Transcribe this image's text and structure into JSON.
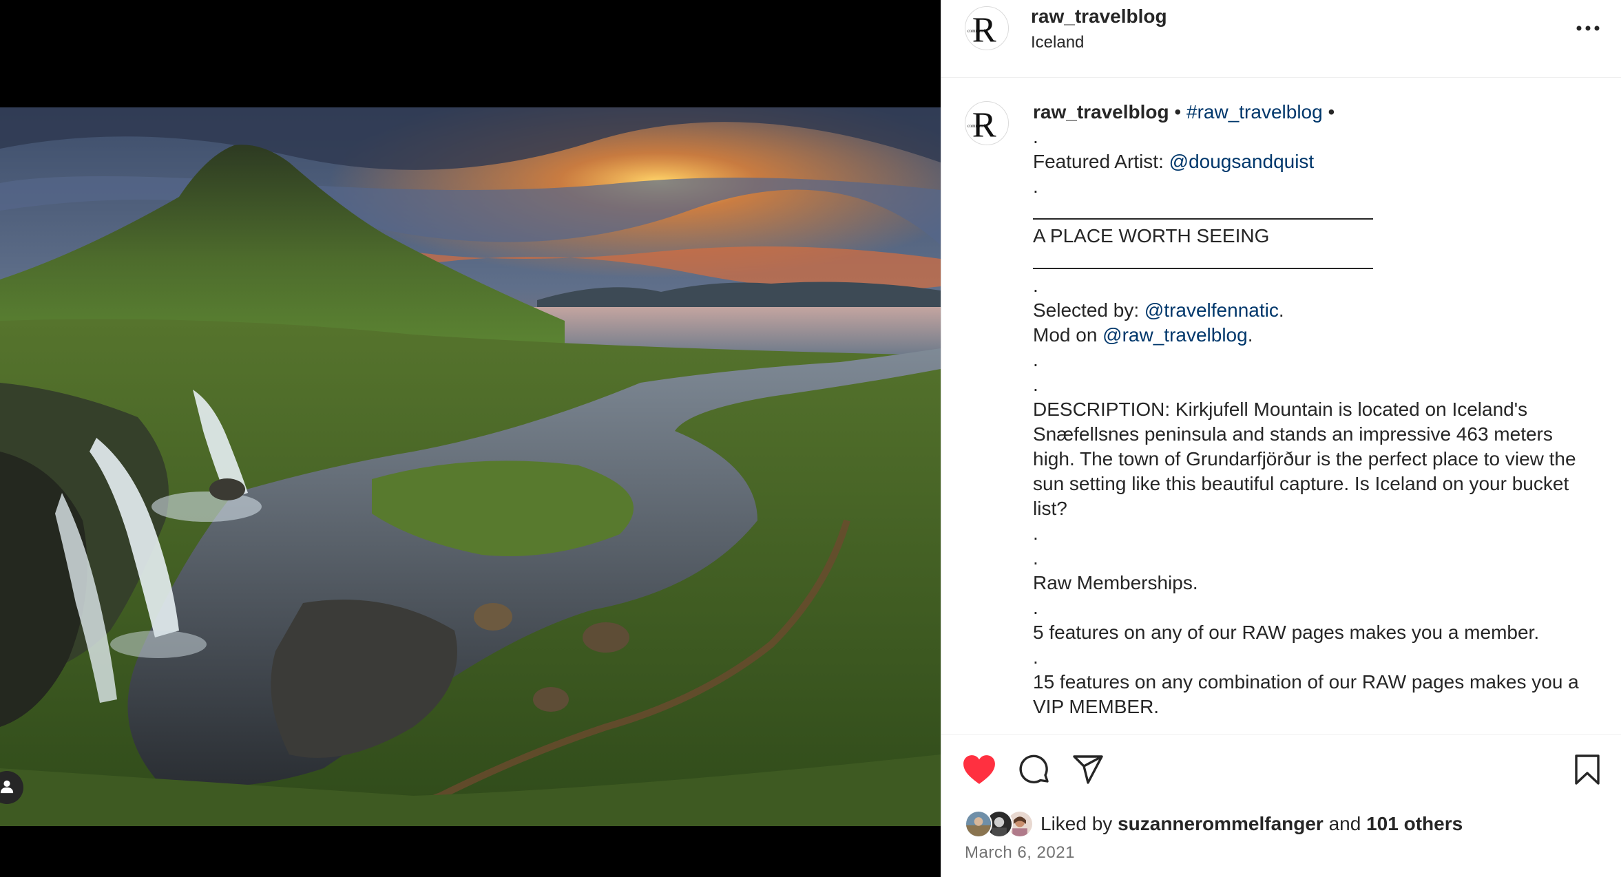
{
  "header": {
    "username": "raw_travelblog",
    "location": "Iceland"
  },
  "caption": {
    "username": "raw_travelblog",
    "sep1": " • ",
    "hashtag": "#raw_travelblog",
    "sep2": " •",
    "dot": ".",
    "featured_prefix": "Featured Artist: ",
    "featured_handle": "@dougsandquist",
    "heading": "A PLACE WORTH SEEING",
    "selected_prefix": "Selected by: ",
    "selected_handle": "@travelfennatic",
    "period": ".",
    "mod_prefix": "Mod on ",
    "mod_handle": "@raw_travelblog",
    "description": "DESCRIPTION: Kirkjufell Mountain is located on Iceland's Snæfellsnes peninsula and stands an impressive 463 meters high. The town of Grundarfjörður is the perfect place to view the sun setting like this beautiful capture. Is Iceland on your bucket list?",
    "memberships": "Raw Memberships.",
    "member_rule": "5 features on any of our RAW pages makes you a member.",
    "vip_rule": "15 features on any combination of our RAW pages makes you a VIP MEMBER."
  },
  "likes": {
    "prefix": "Liked by ",
    "user": "suzannerommelfanger",
    "middle": " and ",
    "others": "101 others"
  },
  "date": "March 6, 2021",
  "icons": {
    "more": "more-horizontal-icon",
    "like": "heart-filled-icon",
    "comment": "comment-icon",
    "share": "paper-plane-icon",
    "save": "bookmark-icon",
    "tag": "person-icon"
  },
  "colors": {
    "like_red": "#ff3040",
    "link_blue": "#00376b",
    "text": "#262626",
    "muted": "#737373"
  }
}
